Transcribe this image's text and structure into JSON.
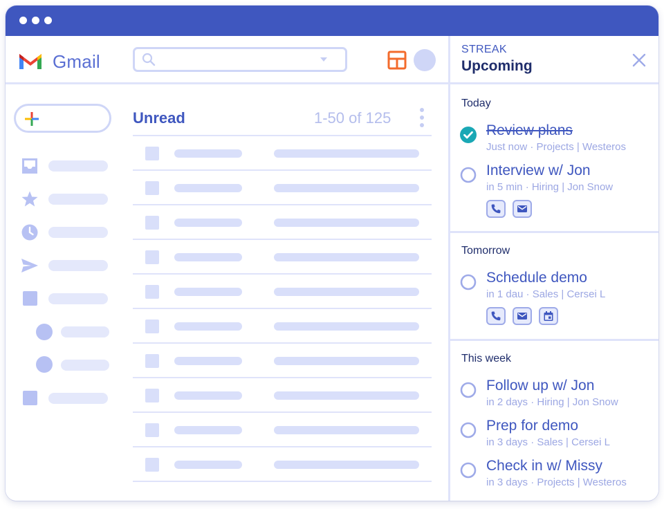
{
  "colors": {
    "titlebar": "#3f57bf",
    "accent": "#3f57bf",
    "heading": "#1f2d6b",
    "muted": "#9ca7e3",
    "placeholder": "#d9dffa",
    "divider": "#dfe3fa",
    "done_check": "#1aa8b5",
    "grid_icon": "#f36b2c"
  },
  "gmail": {
    "app_name": "Gmail",
    "search": {
      "value": "",
      "icon": "search-icon"
    },
    "list": {
      "title": "Unread",
      "count": "1-50 of 125",
      "row_count": 10
    },
    "sidebar_icons": [
      "inbox-icon",
      "star-icon",
      "clock-icon",
      "send-icon",
      "label-icon"
    ]
  },
  "streak": {
    "brand": "STREAK",
    "title": "Upcoming",
    "sections": [
      {
        "title": "Today",
        "tasks": [
          {
            "title": "Review plans",
            "meta": "Just now · Projects | Westeros",
            "done": true,
            "actions": []
          },
          {
            "title": "Interview w/ Jon",
            "meta": "in 5 min · Hiring | Jon Snow",
            "done": false,
            "actions": [
              "phone-icon",
              "email-icon"
            ]
          }
        ]
      },
      {
        "title": "Tomorrow",
        "tasks": [
          {
            "title": "Schedule demo",
            "meta": "in 1 dau · Sales | Cersei L",
            "done": false,
            "actions": [
              "phone-icon",
              "email-icon",
              "calendar-icon"
            ]
          }
        ]
      },
      {
        "title": "This week",
        "tasks": [
          {
            "title": "Follow up w/ Jon",
            "meta": "in 2 days · Hiring | Jon Snow",
            "done": false,
            "actions": []
          },
          {
            "title": "Prep for demo",
            "meta": "in 3 days · Sales | Cersei L",
            "done": false,
            "actions": []
          },
          {
            "title": "Check in w/ Missy",
            "meta": "in 3 days · Projects | Westeros",
            "done": false,
            "actions": []
          }
        ]
      }
    ]
  }
}
